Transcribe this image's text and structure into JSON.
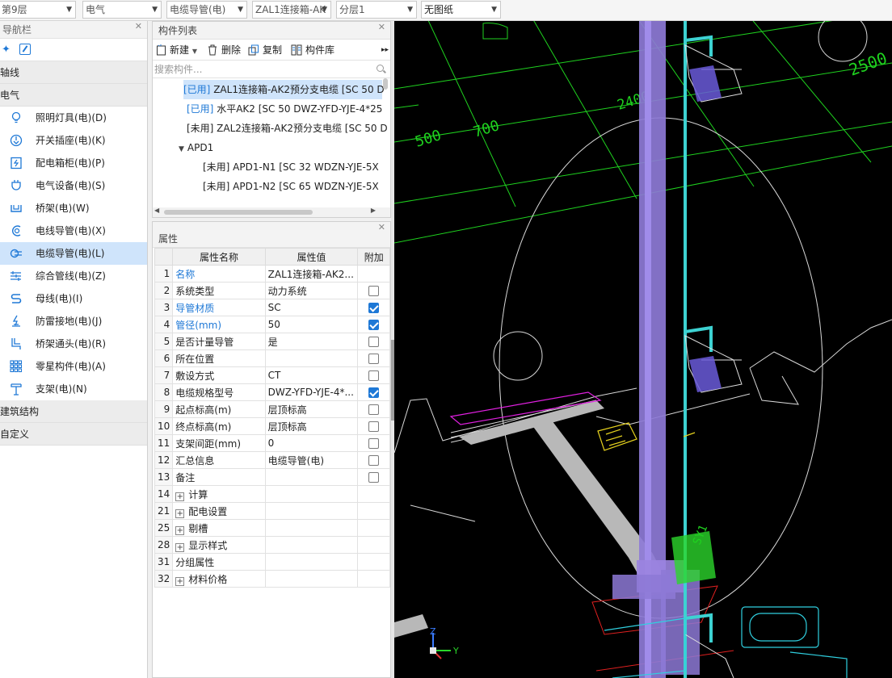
{
  "toolbar": {
    "floor": "第9层",
    "discipline": "电气",
    "category": "电缆导管(电)",
    "component": "ZAL1连接箱-AK",
    "sublayer": "分层1",
    "drawing": "无图纸"
  },
  "nav": {
    "title": "导航栏",
    "groups": {
      "axis": "轴线",
      "electric": "电气",
      "structure": "建筑结构",
      "custom": "自定义"
    },
    "items": [
      {
        "label": "照明灯具(电)(D)"
      },
      {
        "label": "开关插座(电)(K)"
      },
      {
        "label": "配电箱柜(电)(P)"
      },
      {
        "label": "电气设备(电)(S)"
      },
      {
        "label": "桥架(电)(W)"
      },
      {
        "label": "电线导管(电)(X)"
      },
      {
        "label": "电缆导管(电)(L)"
      },
      {
        "label": "综合管线(电)(Z)"
      },
      {
        "label": "母线(电)(I)"
      },
      {
        "label": "防雷接地(电)(J)"
      },
      {
        "label": "桥架通头(电)(R)"
      },
      {
        "label": "零星构件(电)(A)"
      },
      {
        "label": "支架(电)(N)"
      }
    ]
  },
  "component_list": {
    "title": "构件列表",
    "new_label": "新建",
    "delete_label": "删除",
    "copy_label": "复制",
    "library_label": "构件库",
    "search_placeholder": "搜索构件...",
    "rows": [
      {
        "status": "[已用]",
        "text": "ZAL1连接箱-AK2预分支电缆 [SC 50 D"
      },
      {
        "status": "[已用]",
        "text": "水平AK2 [SC 50 DWZ-YFD-YJE-4*25"
      },
      {
        "status": "",
        "text": "[未用] ZAL2连接箱-AK2预分支电缆 [SC 50 D"
      },
      {
        "status": "",
        "text": "APD1"
      },
      {
        "status": "",
        "text": "[未用] APD1-N1 [SC 32 WDZN-YJE-5X"
      },
      {
        "status": "",
        "text": "[未用] APD1-N2 [SC 65 WDZN-YJE-5X"
      }
    ]
  },
  "properties": {
    "title": "属性",
    "col_name": "属性名称",
    "col_value": "属性值",
    "col_extra": "附加",
    "rows": [
      {
        "num": "1",
        "name": "名称",
        "value": "ZAL1连接箱-AK2...",
        "blue": true,
        "checkbox": "none",
        "expand": false
      },
      {
        "num": "2",
        "name": "系统类型",
        "value": "动力系统",
        "blue": false,
        "checkbox": "off",
        "expand": false
      },
      {
        "num": "3",
        "name": "导管材质",
        "value": "SC",
        "blue": true,
        "checkbox": "on",
        "expand": false
      },
      {
        "num": "4",
        "name": "管径(mm)",
        "value": "50",
        "blue": true,
        "checkbox": "on",
        "expand": false
      },
      {
        "num": "5",
        "name": "是否计量导管",
        "value": "是",
        "blue": false,
        "checkbox": "off",
        "expand": false
      },
      {
        "num": "6",
        "name": "所在位置",
        "value": "",
        "blue": false,
        "checkbox": "off",
        "expand": false
      },
      {
        "num": "7",
        "name": "敷设方式",
        "value": "CT",
        "blue": false,
        "checkbox": "off",
        "expand": false
      },
      {
        "num": "8",
        "name": "电缆规格型号",
        "value": "DWZ-YFD-YJE-4*...",
        "blue": false,
        "checkbox": "on",
        "expand": false
      },
      {
        "num": "9",
        "name": "起点标高(m)",
        "value": "层顶标高",
        "blue": false,
        "checkbox": "off",
        "expand": false
      },
      {
        "num": "10",
        "name": "终点标高(m)",
        "value": "层顶标高",
        "blue": false,
        "checkbox": "off",
        "expand": false
      },
      {
        "num": "11",
        "name": "支架间距(mm)",
        "value": "0",
        "blue": false,
        "checkbox": "off",
        "expand": false
      },
      {
        "num": "12",
        "name": "汇总信息",
        "value": "电缆导管(电)",
        "blue": false,
        "checkbox": "off",
        "expand": false
      },
      {
        "num": "13",
        "name": "备注",
        "value": "",
        "blue": false,
        "checkbox": "off",
        "expand": false
      },
      {
        "num": "14",
        "name": "计算",
        "value": "",
        "blue": false,
        "checkbox": "none",
        "expand": true
      },
      {
        "num": "21",
        "name": "配电设置",
        "value": "",
        "blue": false,
        "checkbox": "none",
        "expand": true
      },
      {
        "num": "25",
        "name": "剔槽",
        "value": "",
        "blue": false,
        "checkbox": "none",
        "expand": true
      },
      {
        "num": "28",
        "name": "显示样式",
        "value": "",
        "blue": false,
        "checkbox": "none",
        "expand": true
      },
      {
        "num": "31",
        "name": "分组属性",
        "value": "",
        "blue": false,
        "checkbox": "none",
        "expand": false
      },
      {
        "num": "32",
        "name": "材料价格",
        "value": "",
        "blue": false,
        "checkbox": "none",
        "expand": true
      }
    ]
  },
  "viewport": {
    "dim_labels": [
      "500",
      "700",
      "2400",
      "2500"
    ],
    "axis_z": "Z",
    "axis_y": "Y",
    "tag_label": "SY1"
  }
}
